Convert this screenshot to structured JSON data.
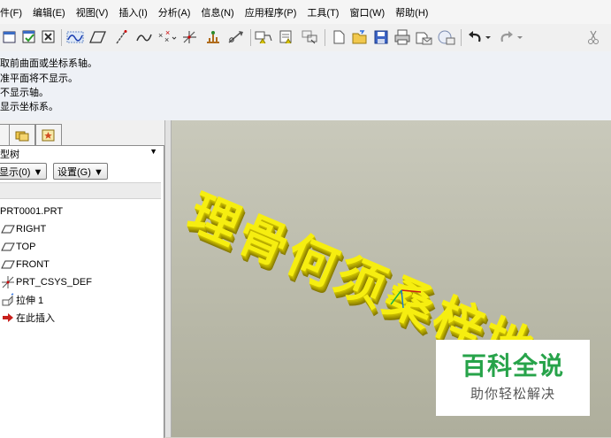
{
  "menu": [
    "件(F)",
    "编辑(E)",
    "视图(V)",
    "插入(I)",
    "分析(A)",
    "信息(N)",
    "应用程序(P)",
    "工具(T)",
    "窗口(W)",
    "帮助(H)"
  ],
  "toolbar": {
    "icons": [
      "close-window-icon",
      "repaint-icon",
      "close-icon",
      "datum-curve-icon",
      "datum-plane-icon",
      "axis-icon",
      "sketched-curve-icon",
      "point-icon",
      "csys-icon",
      "datum-analysis-icon",
      "curve-from-equation-icon",
      "annotation-icon",
      "annotation-feature-icon",
      "select-icon",
      "new-file-icon",
      "open-file-icon",
      "save-icon",
      "print-icon",
      "send-mail-icon",
      "send-link-icon",
      "undo-icon",
      "dropdown-icon",
      "redo-icon",
      "dropdown-icon",
      "cut-icon"
    ]
  },
  "messages": [
    "取前曲面或坐标系轴。",
    "准平面将不显示。",
    "不显示轴。",
    "显示坐标系。"
  ],
  "model_tree": {
    "header": "型树",
    "show_button": "显示(0) ▼",
    "settings_button": "设置(G) ▼",
    "items": [
      {
        "icon": "part-icon",
        "label": "PRT0001.PRT"
      },
      {
        "icon": "datum-plane-icon",
        "label": "RIGHT"
      },
      {
        "icon": "datum-plane-icon",
        "label": "TOP"
      },
      {
        "icon": "datum-plane-icon",
        "label": "FRONT"
      },
      {
        "icon": "csys-icon",
        "label": "PRT_CSYS_DEF"
      },
      {
        "icon": "extrude-icon",
        "label": "拉伸 1"
      },
      {
        "icon": "insert-here-icon",
        "label": "在此插入"
      }
    ]
  },
  "viewport": {
    "model_text": "理骨何须桑梓地"
  },
  "watermark": {
    "title": "百科全说",
    "subtitle": "助你轻松解决"
  },
  "colors": {
    "text3d": "#f6ee10",
    "watermark_green": "#27a34a",
    "viewport_bg": "#bdbdac"
  }
}
